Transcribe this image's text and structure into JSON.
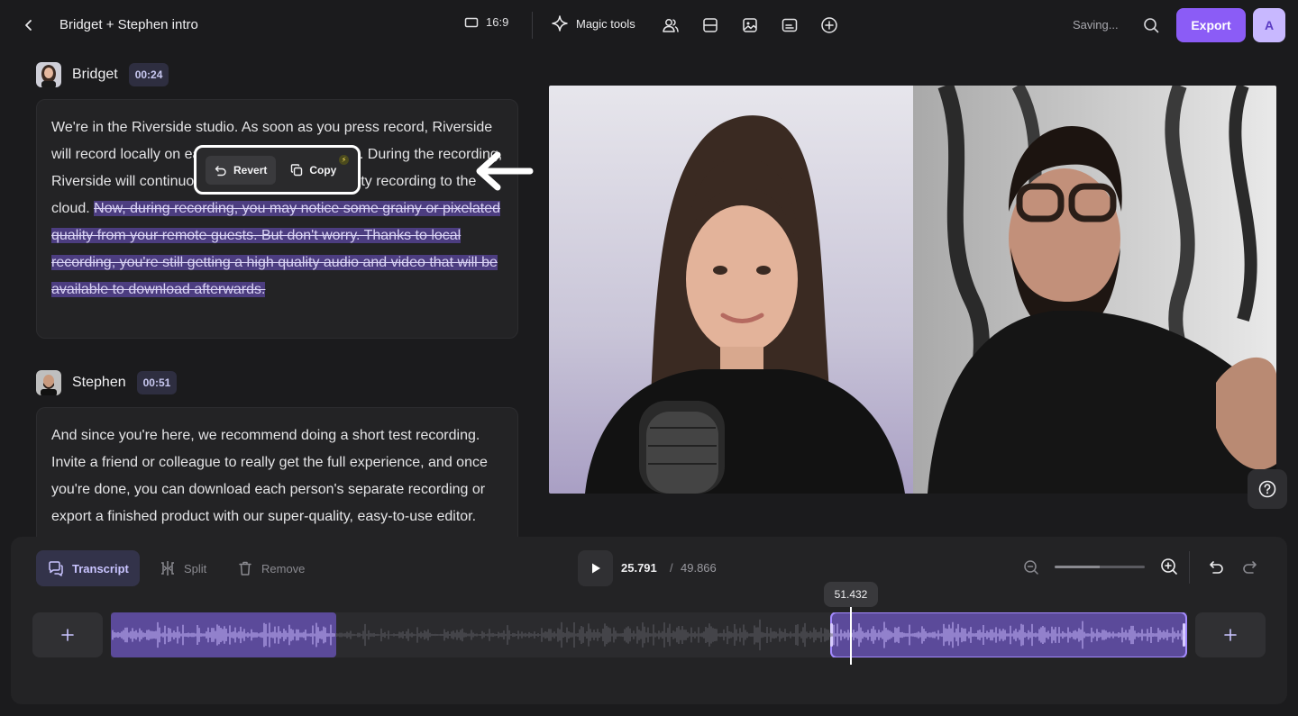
{
  "header": {
    "title": "Bridget + Stephen intro",
    "aspect_ratio": "16:9",
    "magic_tools_label": "Magic tools",
    "status": "Saving...",
    "export_label": "Export",
    "user_initial": "A"
  },
  "transcript": {
    "speakers": [
      {
        "name": "Bridget",
        "time": "00:24",
        "text_kept": "We're in the Riverside studio. As soon as you press record, Riverside will record locally on each participant's computer. During the recording, Riverside will continuously upload that high quality recording to the cloud. ",
        "text_removed": "Now, during recording, you may notice some grainy or pixelated quality from your remote guests. But don't worry. Thanks to local recording, you're still getting a high quality audio and video that will be available to download afterwards."
      },
      {
        "name": "Stephen",
        "time": "00:51",
        "text_kept": "And since you're here, we recommend doing a short test recording. Invite a friend or colleague to really get the full experience, and once you're done, you can download each person's separate recording or export a finished product with our super-quality, easy-to-use editor. Should we get started?"
      }
    ],
    "popup": {
      "revert_label": "Revert",
      "copy_label": "Copy"
    }
  },
  "timeline": {
    "tools": {
      "transcript_label": "Transcript",
      "split_label": "Split",
      "remove_label": "Remove"
    },
    "current_time": "25.791",
    "separator": "/",
    "total_time": "49.866",
    "playhead_time": "51.432",
    "zoom_level": 0.5
  },
  "colors": {
    "accent": "#8b5cf6",
    "selection": "#4c3d80",
    "clip": "#5b4a9a",
    "background": "#1b1b1d"
  },
  "icons": [
    "chevron-left-icon",
    "aspect-ratio-icon",
    "sparkle-icon",
    "people-icon",
    "layout-icon",
    "image-icon",
    "captions-icon",
    "plus-circle-icon",
    "search-icon",
    "revert-icon",
    "copy-icon",
    "bolt-icon",
    "arrow-left-icon",
    "help-icon",
    "transcript-icon",
    "split-icon",
    "trash-icon",
    "play-icon",
    "zoom-out-icon",
    "zoom-in-icon",
    "undo-icon",
    "redo-icon",
    "plus-icon"
  ]
}
